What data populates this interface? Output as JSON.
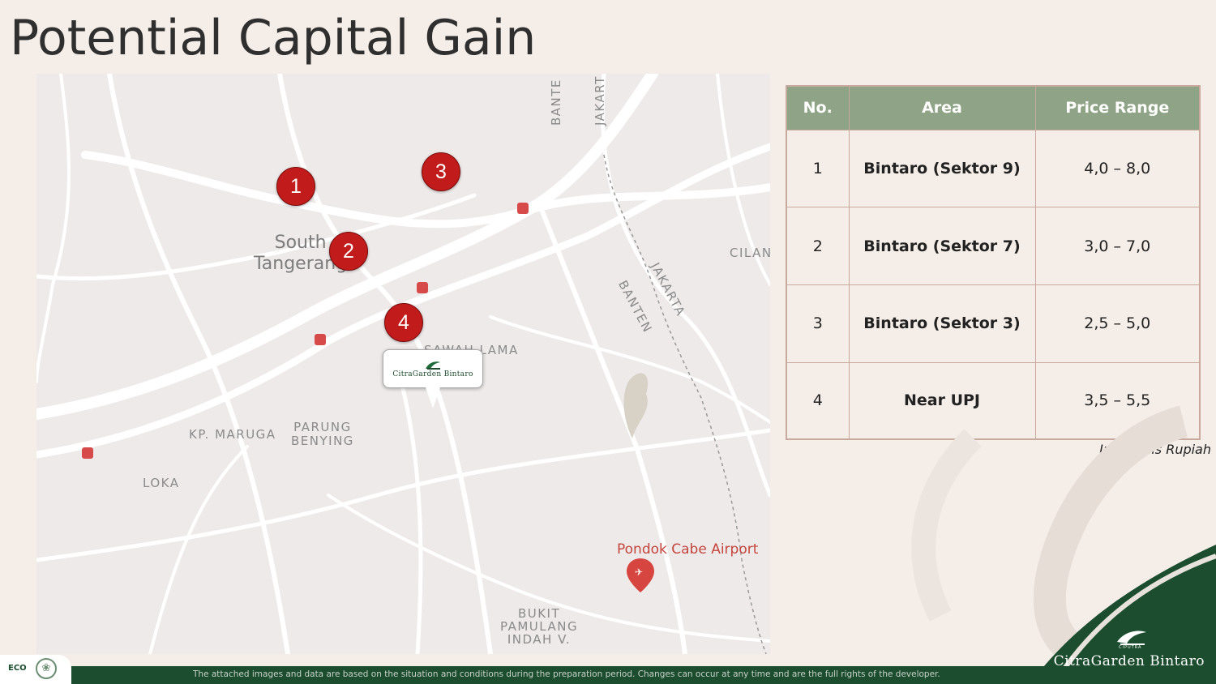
{
  "title": "Potential Capital Gain",
  "map": {
    "labels": {
      "south_tangerang": "South\nTangerang",
      "sawah_lama": "SAWAH LAMA",
      "kp_maruga": "KP. MARUGA",
      "parung_benying": "PARUNG\nBENYING",
      "loka": "LOKA",
      "bukit_pamulang": "BUKIT\nPAMULANG\nINDAH V.",
      "airport": "Pondok Cabe Airport",
      "jakarta_top": "JAKART",
      "banten_top": "BANTE",
      "jakarta_mid": "JAKARTA",
      "banten_mid": "BANTEN",
      "cilan": "CILAN"
    },
    "markers": [
      "1",
      "2",
      "3",
      "4"
    ],
    "callout_brand": "CitraGarden Bintaro"
  },
  "table": {
    "headers": [
      "No.",
      "Area",
      "Price Range"
    ],
    "rows": [
      {
        "no": "1",
        "area": "Bintaro (Sektor 9)",
        "price": "4,0 – 8,0"
      },
      {
        "no": "2",
        "area": "Bintaro (Sektor 7)",
        "price": "3,0 – 7,0"
      },
      {
        "no": "3",
        "area": "Bintaro (Sektor 3)",
        "price": "2,5 – 5,0"
      },
      {
        "no": "4",
        "area": "Near UPJ",
        "price": "3,5 – 5,5"
      }
    ],
    "note": "In Billions Rupiah"
  },
  "footer": {
    "disclaimer": "The attached images and data are based on the situation and conditions during the preparation period. Changes can occur at any time and are the full rights of the developer.",
    "eco": "ECO",
    "brand": "CitraGarden Bintaro",
    "brand_small": "CIPUTRA"
  },
  "colors": {
    "background": "#f4ede8",
    "header_green": "#8fa486",
    "marker_red": "#c11b1b",
    "footer_green": "#1b4d2e"
  }
}
